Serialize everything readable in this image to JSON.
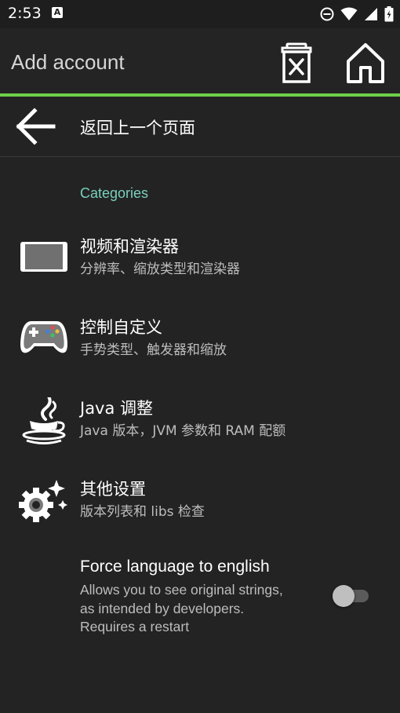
{
  "status_bar": {
    "time": "2:53",
    "notification_glyph": "A",
    "icons": [
      "dnd-icon",
      "wifi-icon",
      "signal-icon",
      "battery-icon"
    ]
  },
  "toolbar": {
    "title": "Add account",
    "accent_color": "#6fd04a"
  },
  "back": {
    "label": "返回上一个页面"
  },
  "section": {
    "header": "Categories",
    "header_color": "#78d0bb"
  },
  "items": [
    {
      "title": "视频和渲染器",
      "subtitle": "分辨率、缩放类型和渲染器",
      "icon": "display-icon"
    },
    {
      "title": "控制自定义",
      "subtitle": "手势类型、触发器和缩放",
      "icon": "gamepad-icon"
    },
    {
      "title": "Java 调整",
      "subtitle": "Java 版本，JVM 参数和 RAM 配额",
      "icon": "java-icon"
    },
    {
      "title": "其他设置",
      "subtitle": "版本列表和 libs 检查",
      "icon": "gear-sparkle-icon"
    }
  ],
  "force_language": {
    "title": "Force language to english",
    "line1": "Allows you to see original strings,",
    "line2": "as intended by developers.",
    "line3": "Requires a restart",
    "enabled": false
  }
}
